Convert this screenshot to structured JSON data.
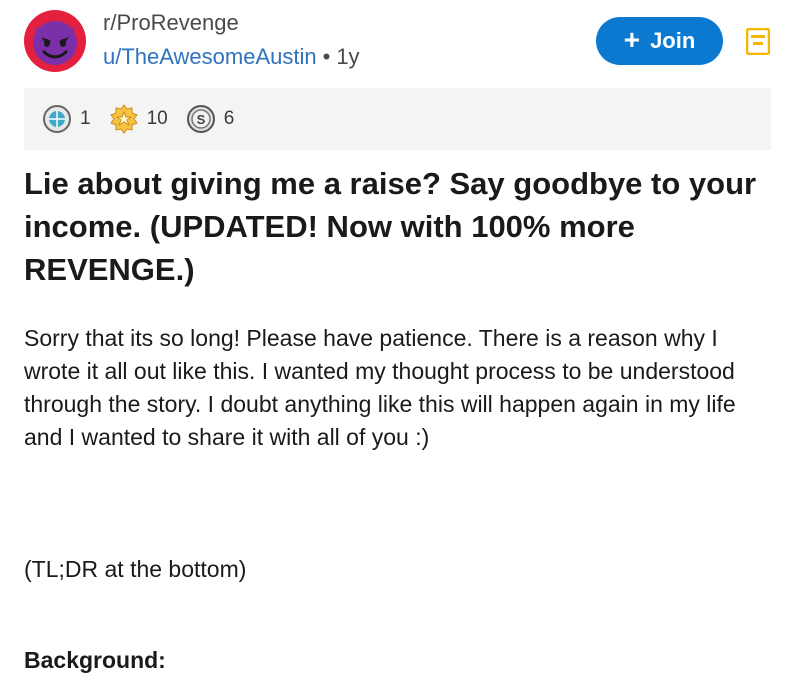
{
  "header": {
    "subreddit": "r/ProRevenge",
    "username": "u/TheAwesomeAustin",
    "separator": "•",
    "age": "1y",
    "join_label": "Join",
    "join_plus": "+"
  },
  "awards": [
    {
      "icon": "globe-award-icon",
      "count": "1"
    },
    {
      "icon": "star-award-icon",
      "count": "10"
    },
    {
      "icon": "silver-coin-award-icon",
      "count": "6"
    }
  ],
  "post": {
    "title": "Lie about giving me a raise? Say goodbye to your income. (UPDATED! Now with 100% more REVENGE.)",
    "body": "Sorry that its so long! Please have patience. There is a reason why I wrote it all out like this. I wanted my thought process to be understood through the story. I doubt anything like this will happen again in my life and I wanted to share it with all of you :)",
    "tldr": "(TL;DR at the bottom)",
    "section_heading": "Background:"
  },
  "colors": {
    "join_button": "#0b79d0",
    "username_link": "#2f72bd",
    "avatar_ring": "#e5203f",
    "awards_background": "#f4f4f4"
  }
}
